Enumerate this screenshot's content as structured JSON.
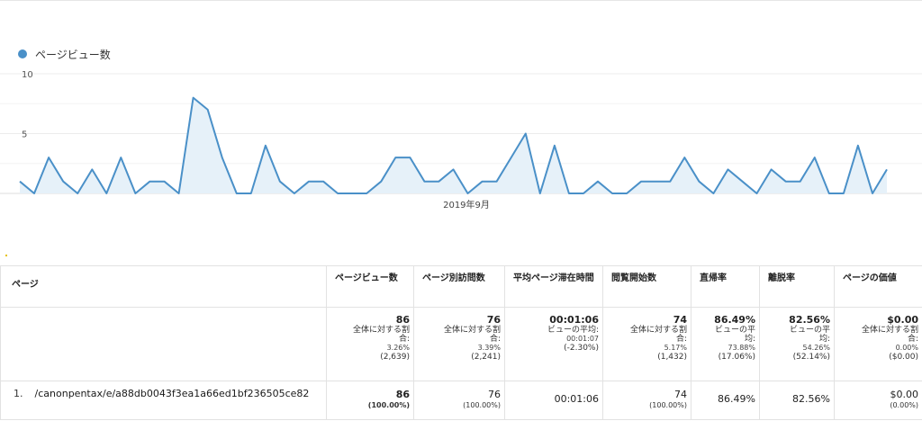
{
  "chart_data": {
    "type": "area",
    "legend": "ページビュー数",
    "color": "#4a90c8",
    "fill": "#e6f1f9",
    "y_ticks": [
      "10",
      "5"
    ],
    "ylim": [
      0,
      10
    ],
    "x_label": "2019年9月",
    "values": [
      1,
      0,
      3,
      1,
      0,
      2,
      0,
      3,
      0,
      1,
      1,
      0,
      8,
      7,
      3,
      0,
      0,
      4,
      1,
      0,
      1,
      1,
      0,
      0,
      0,
      1,
      3,
      3,
      1,
      1,
      2,
      0,
      1,
      1,
      3,
      5,
      0,
      4,
      0,
      0,
      1,
      0,
      0,
      1,
      1,
      1,
      3,
      1,
      0,
      2,
      1,
      0,
      2,
      1,
      1,
      3,
      0,
      0,
      4,
      0,
      2
    ]
  },
  "table": {
    "headers": [
      "ページ",
      "ページビュー数",
      "ページ別訪問数",
      "平均ページ滞在時間",
      "閲覧開始数",
      "直帰率",
      "離脱率",
      "ページの価値"
    ],
    "totals": [
      {
        "main": "86",
        "sub1": "全体に対する割",
        "sub2": "合:",
        "pct": "3.26%",
        "base": "(2,639)"
      },
      {
        "main": "76",
        "sub1": "全体に対する割",
        "sub2": "合:",
        "pct": "3.39%",
        "base": "(2,241)"
      },
      {
        "main": "00:01:06",
        "sub1": "ビューの平均:",
        "sub2": "",
        "pct": "00:01:07",
        "base": "(-2.30%)"
      },
      {
        "main": "74",
        "sub1": "全体に対する割",
        "sub2": "合:",
        "pct": "5.17%",
        "base": "(1,432)"
      },
      {
        "main": "86.49%",
        "sub1": "ビューの平",
        "sub2": "均:",
        "pct": "73.88%",
        "base": "(17.06%)"
      },
      {
        "main": "82.56%",
        "sub1": "ビューの平",
        "sub2": "均:",
        "pct": "54.26%",
        "base": "(52.14%)"
      },
      {
        "main": "$0.00",
        "sub1": "全体に対する割",
        "sub2": "合:",
        "pct": "0.00%",
        "base": "($0.00)"
      }
    ],
    "rows": [
      {
        "num": "1.",
        "page": "/canonpentax/e/a88db0043f3ea1a66ed1bf236505ce82",
        "pageviews": "86",
        "pageviews_pct": "(100.00%)",
        "visits": "76",
        "visits_pct": "(100.00%)",
        "avg_time": "00:01:06",
        "entrances": "74",
        "entrances_pct": "(100.00%)",
        "bounce": "86.49%",
        "exit": "82.56%",
        "value": "$0.00",
        "value_pct": "(0.00%)"
      }
    ]
  }
}
